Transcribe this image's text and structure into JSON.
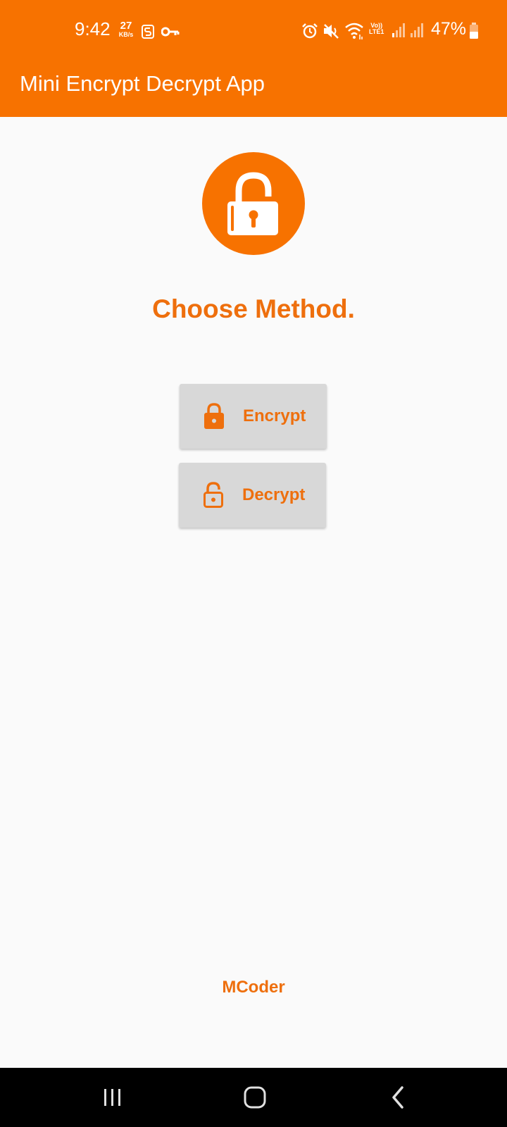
{
  "status_bar": {
    "time": "9:42",
    "net_speed_value": "27",
    "net_speed_unit": "KB/s",
    "volte_top": "Vo))",
    "volte_bottom": "LTE1",
    "battery_percent": "47%",
    "icons": [
      "s-coin-icon",
      "vpn-key-icon",
      "alarm-icon",
      "mute-icon",
      "wifi-icon",
      "signal-icon",
      "signal-icon",
      "battery-icon"
    ]
  },
  "app_bar": {
    "title": "Mini Encrypt Decrypt App"
  },
  "main": {
    "heading": "Choose Method.",
    "buttons": [
      {
        "label": "Encrypt",
        "icon": "lock-closed-icon"
      },
      {
        "label": "Decrypt",
        "icon": "lock-open-icon"
      }
    ],
    "footer": "MCoder"
  },
  "nav_bar": {
    "icons": [
      "recent-apps-icon",
      "home-icon",
      "back-icon"
    ]
  },
  "colors": {
    "accent": "#f77200",
    "text_accent": "#ee6f0d",
    "button_bg": "#d8d8d8",
    "background": "#fafafa"
  }
}
